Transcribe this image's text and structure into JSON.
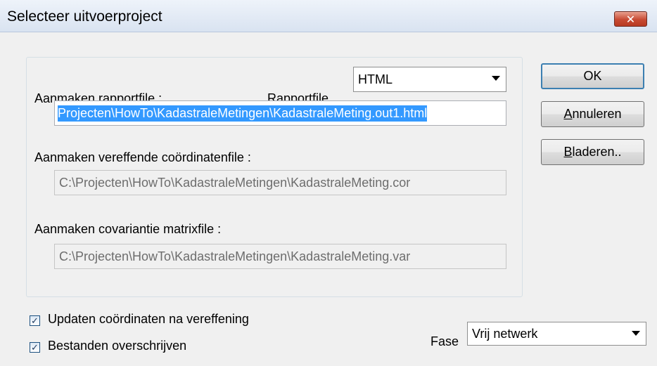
{
  "dialog": {
    "title": "Selecteer uitvoerproject",
    "close_glyph": "✕"
  },
  "report": {
    "label": "Aanmaken rapportfile :",
    "type_label": "Rapportfile",
    "type_value": "HTML",
    "path": "Projecten\\HowTo\\KadastraleMetingen\\KadastraleMeting.out1.html"
  },
  "coordinates": {
    "label": "Aanmaken vereffende coördinatenfile :",
    "path": "C:\\Projecten\\HowTo\\KadastraleMetingen\\KadastraleMeting.cor"
  },
  "covariance": {
    "label": "Aanmaken covariantie matrixfile :",
    "path": "C:\\Projecten\\HowTo\\KadastraleMetingen\\KadastraleMeting.var"
  },
  "buttons": {
    "ok": "OK",
    "cancel_first": "A",
    "cancel_rest": "nnuleren",
    "browse_first": "B",
    "browse_rest": "laderen.."
  },
  "options": {
    "update_coords": {
      "label": "Updaten coördinaten na vereffening",
      "checked": true,
      "mark": "✓"
    },
    "overwrite": {
      "label": "Bestanden overschrijven",
      "checked": true,
      "mark": "✓"
    }
  },
  "phase": {
    "label": "Fase",
    "value": "Vrij netwerk"
  },
  "colors": {
    "selection": "#3399ff",
    "default_button_border": "#3c7fb1",
    "close_button": "#c74a33"
  }
}
